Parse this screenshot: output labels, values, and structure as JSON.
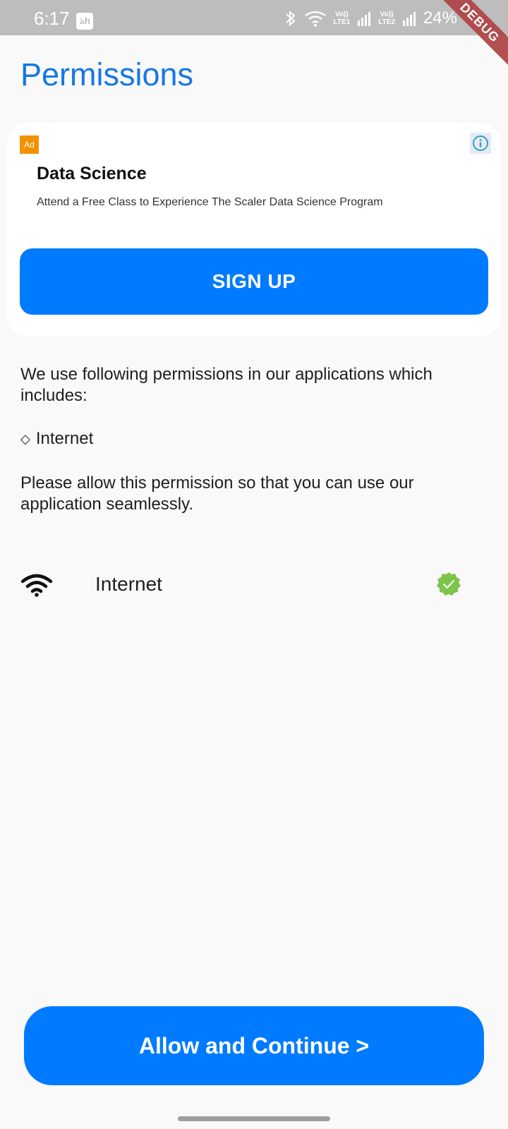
{
  "status_bar": {
    "time": "6:17",
    "notification_glyph": "ঌh",
    "lte1_top": "Vo))",
    "lte1_bottom": "LTE1",
    "lte2_top": "Vo))",
    "lte2_bottom": "LTE2",
    "battery": "24%",
    "debug_banner": "DEBUG",
    "icons": [
      "bluetooth-icon",
      "wifi-icon",
      "signal-icon",
      "signal-icon"
    ]
  },
  "header": {
    "title": "Permissions"
  },
  "ad": {
    "badge": "Ad",
    "headline": "Data Science",
    "body": "Attend a Free Class to Experience The Scaler Data Science Program",
    "cta": "SIGN UP",
    "info_icon": "info-icon"
  },
  "content": {
    "intro": "We use following permissions in our applications which includes:",
    "bullet_symbol": "◇",
    "bullet_item": "Internet",
    "allow_text": "Please allow this permission so that you can use our application seamlessly."
  },
  "permissions": [
    {
      "label": "Internet",
      "icon": "wifi-icon",
      "granted": true
    }
  ],
  "footer": {
    "button": "Allow and Continue >"
  },
  "colors": {
    "accent": "#007bff",
    "title": "#1677e6",
    "granted": "#7cc44a",
    "ad_badge": "#f39200"
  }
}
